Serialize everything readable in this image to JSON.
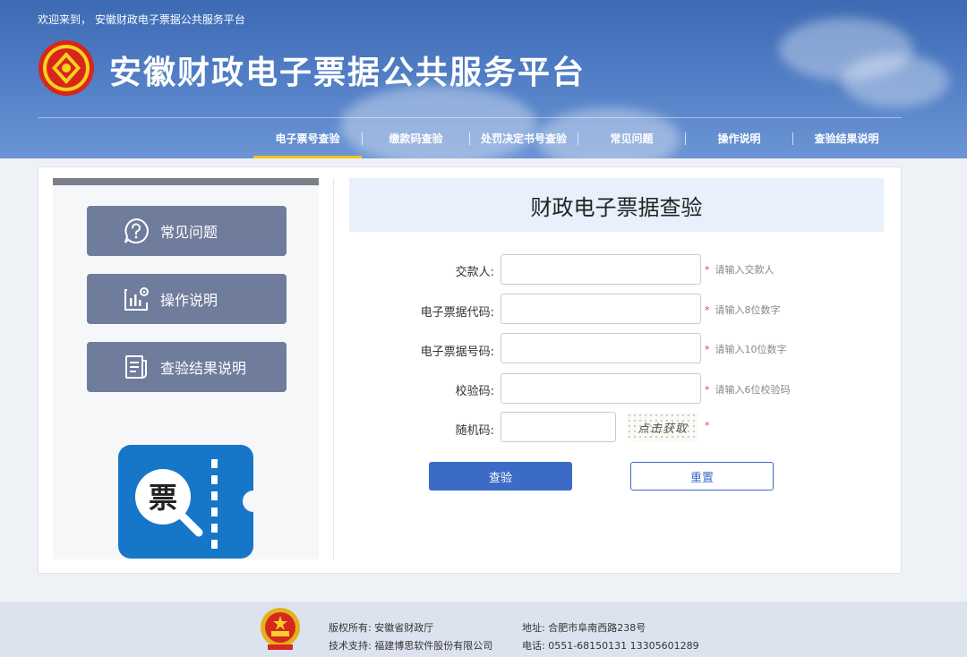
{
  "header": {
    "welcome": "欢迎来到， 安徽财政电子票据公共服务平台",
    "site_title": "安徽财政电子票据公共服务平台"
  },
  "nav": {
    "items": [
      {
        "label": "电子票号查验",
        "active": true
      },
      {
        "label": "缴款码查验",
        "active": false
      },
      {
        "label": "处罚决定书号查验",
        "active": false
      },
      {
        "label": "常见问题",
        "active": false
      },
      {
        "label": "操作说明",
        "active": false
      },
      {
        "label": "查验结果说明",
        "active": false
      }
    ]
  },
  "sidebar": {
    "buttons": [
      {
        "label": "常见问题",
        "icon": "question-icon"
      },
      {
        "label": "操作说明",
        "icon": "chart-doc-icon"
      },
      {
        "label": "查验结果说明",
        "icon": "document-icon"
      }
    ],
    "app_icon_text": "票"
  },
  "form": {
    "title": "财政电子票据查验",
    "fields": [
      {
        "label": "交款人:",
        "value": "",
        "hint": "请输入交款人"
      },
      {
        "label": "电子票据代码:",
        "value": "",
        "hint": "请输入8位数字"
      },
      {
        "label": "电子票据号码:",
        "value": "",
        "hint": "请输入10位数字"
      },
      {
        "label": "校验码:",
        "value": "",
        "hint": "请输入6位校验码"
      },
      {
        "label": "随机码:",
        "value": "",
        "hint": ""
      }
    ],
    "required_mark": "*",
    "captcha_text": "点击获取",
    "submit_label": "查验",
    "reset_label": "重置"
  },
  "footer": {
    "copyright": "版权所有: 安徽省财政厅",
    "support": "技术支持: 福建博思软件股份有限公司",
    "address": "地址: 合肥市阜南西路238号",
    "phone": "电话: 0551-68150131 13305601289"
  },
  "colors": {
    "header_blue": "#3d6ab3",
    "nav_active_underline": "#f5c518",
    "sidebar_button": "#6f7c9c",
    "primary_button": "#3c6ac7",
    "app_icon_blue": "#1677c9",
    "required_star": "#e0454b"
  }
}
